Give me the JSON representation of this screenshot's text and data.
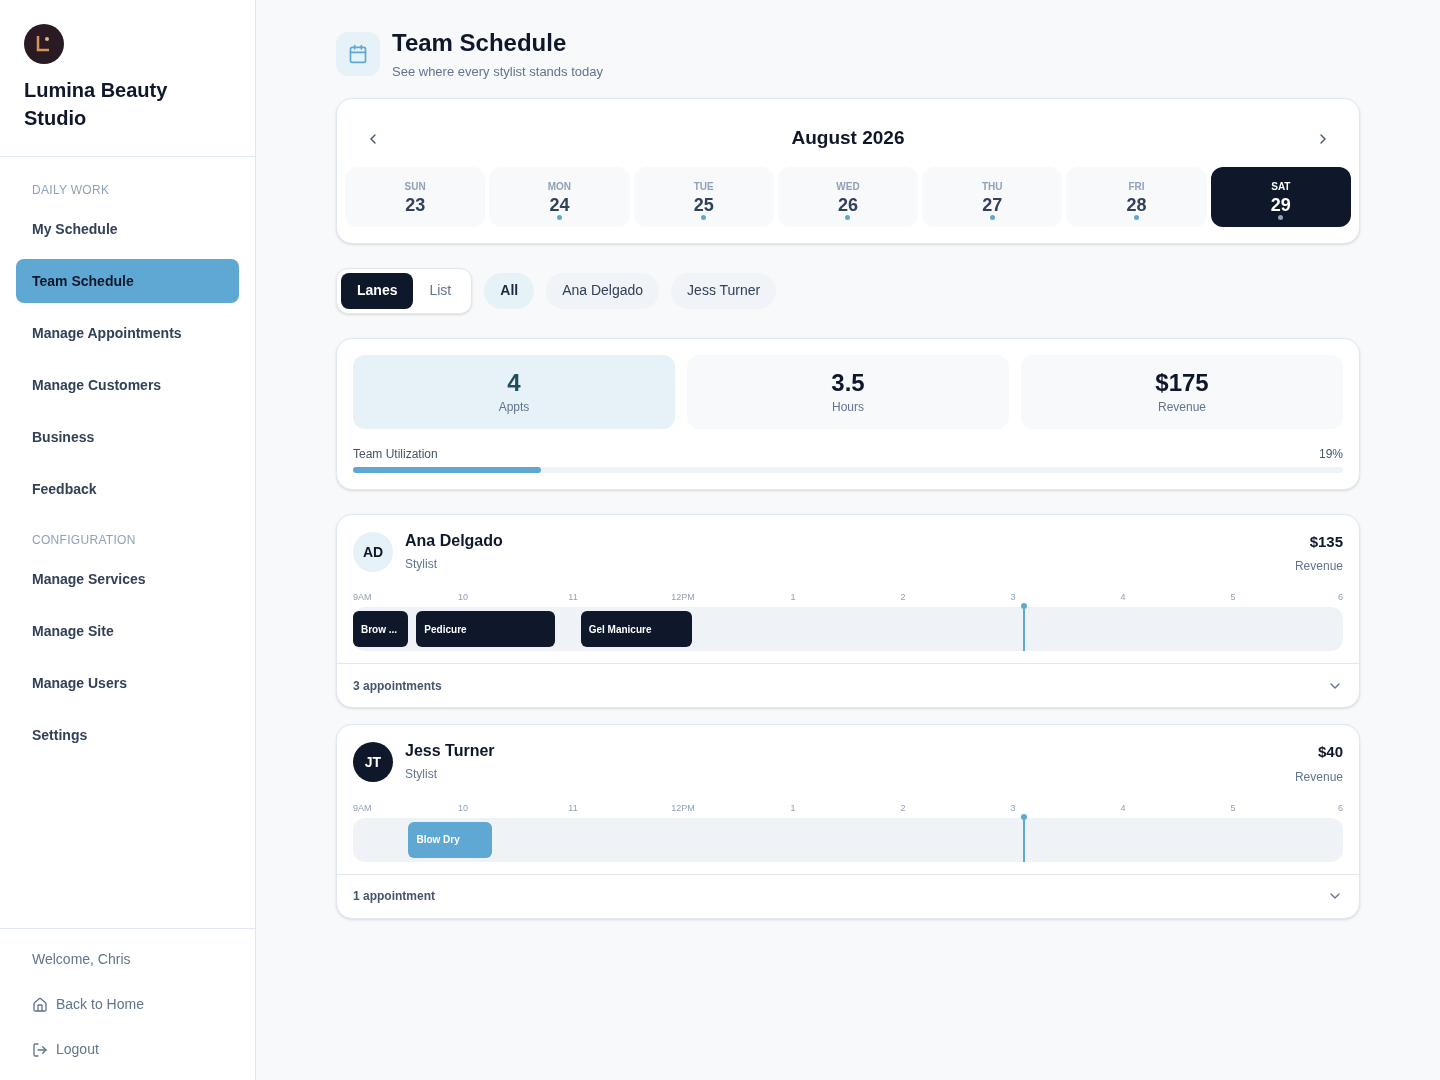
{
  "brand": {
    "name": "Lumina Beauty Studio"
  },
  "sidebar": {
    "sections": [
      {
        "heading": "DAILY WORK",
        "items": [
          {
            "label": "My Schedule",
            "selected": false
          },
          {
            "label": "Team Schedule",
            "selected": true
          },
          {
            "label": "Manage Appointments",
            "selected": false
          },
          {
            "label": "Manage Customers",
            "selected": false
          },
          {
            "label": "Business",
            "selected": false
          },
          {
            "label": "Feedback",
            "selected": false
          }
        ]
      },
      {
        "heading": "CONFIGURATION",
        "items": [
          {
            "label": "Manage Services",
            "selected": false
          },
          {
            "label": "Manage Site",
            "selected": false
          },
          {
            "label": "Manage Users",
            "selected": false
          },
          {
            "label": "Settings",
            "selected": false
          }
        ]
      }
    ],
    "welcome": "Welcome, Chris",
    "links": [
      {
        "kind": "home",
        "label": "Back to Home"
      },
      {
        "kind": "logout",
        "label": "Logout"
      }
    ]
  },
  "header": {
    "title": "Team Schedule",
    "subtitle": "See where every stylist stands today"
  },
  "calendar": {
    "month": "August 2026",
    "days": [
      {
        "weekday": "SUN",
        "date": "23",
        "selected": false,
        "has_appointments": false
      },
      {
        "weekday": "MON",
        "date": "24",
        "selected": false,
        "has_appointments": true
      },
      {
        "weekday": "TUE",
        "date": "25",
        "selected": false,
        "has_appointments": true
      },
      {
        "weekday": "WED",
        "date": "26",
        "selected": false,
        "has_appointments": true
      },
      {
        "weekday": "THU",
        "date": "27",
        "selected": false,
        "has_appointments": true
      },
      {
        "weekday": "FRI",
        "date": "28",
        "selected": false,
        "has_appointments": true
      },
      {
        "weekday": "SAT",
        "date": "29",
        "selected": true,
        "has_appointments": true
      }
    ]
  },
  "view_toggle": [
    {
      "label": "Lanes",
      "selected": true
    },
    {
      "label": "List",
      "selected": false
    }
  ],
  "filters": [
    {
      "label": "All",
      "selected": true
    },
    {
      "label": "Ana Delgado",
      "selected": false
    },
    {
      "label": "Jess Turner",
      "selected": false
    }
  ],
  "stats": [
    {
      "value": "4",
      "label": "Appts",
      "selected": true
    },
    {
      "value": "3.5",
      "label": "Hours",
      "selected": false
    },
    {
      "value": "$175",
      "label": "Revenue",
      "selected": false
    }
  ],
  "utilization": {
    "label": "Team Utilization",
    "reading": "19%",
    "level": 0.19
  },
  "lanes": [
    {
      "initials": "AD",
      "name": "Ana Delgado",
      "role": "Stylist",
      "revenue": "$135",
      "revenue_label": "Revenue",
      "avatar_dark": false,
      "count": "3 appointments",
      "expanded": false,
      "hour_ticks": [
        "9AM",
        "10",
        "11",
        "12PM",
        "1",
        "2",
        "3",
        "4",
        "5",
        "6"
      ],
      "appointments": [
        {
          "title": "Brow ...",
          "color": "#0f172a"
        },
        {
          "title": "Pedicure",
          "color": "#0f172a"
        },
        {
          "title": "Gel Manicure",
          "color": "#0f172a"
        }
      ]
    },
    {
      "initials": "JT",
      "name": "Jess Turner",
      "role": "Stylist",
      "revenue": "$40",
      "revenue_label": "Revenue",
      "avatar_dark": true,
      "count": "1 appointment",
      "expanded": false,
      "hour_ticks": [
        "9AM",
        "10",
        "11",
        "12PM",
        "1",
        "2",
        "3",
        "4",
        "5",
        "6"
      ],
      "appointments": [
        {
          "title": "Blow Dry",
          "color": "#5fa8d3"
        }
      ]
    }
  ]
}
